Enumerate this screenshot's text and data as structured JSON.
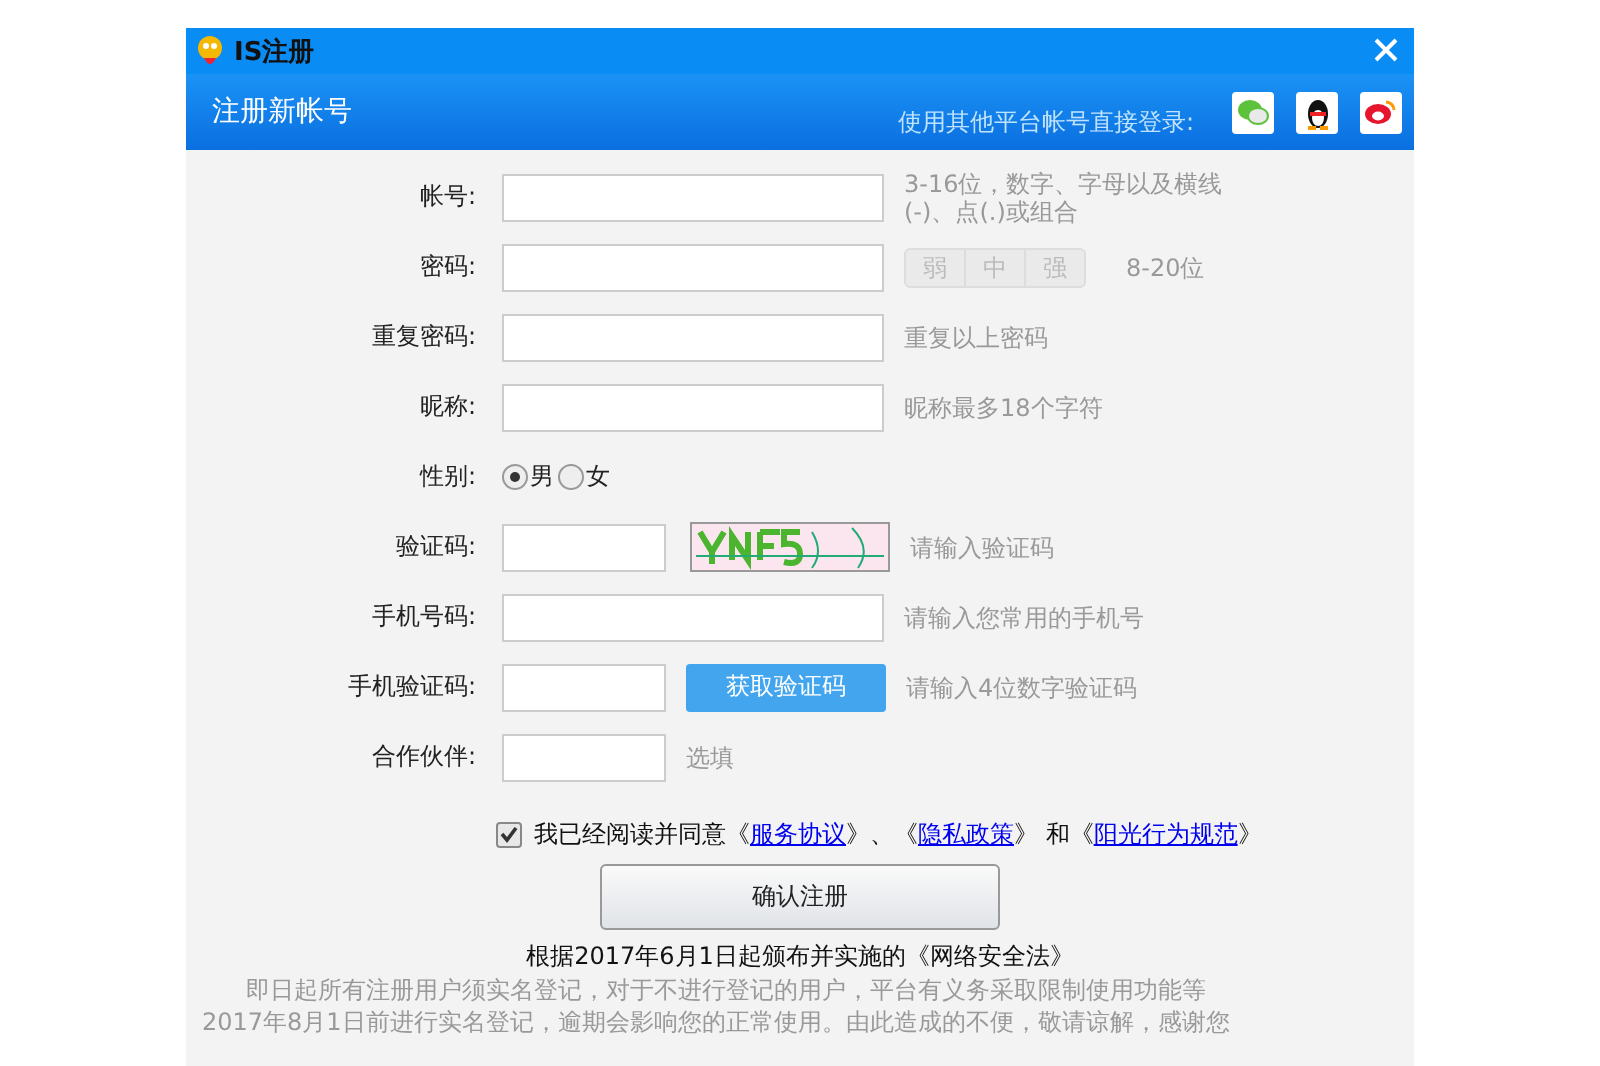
{
  "window": {
    "title": "IS注册"
  },
  "header": {
    "title": "注册新帐号",
    "social_label": "使用其他平台帐号直接登录:"
  },
  "rows": [
    {
      "kind": "input",
      "label": "帐号:",
      "hint": "3-16位，数字、字母以及横线(-)、点(.)或组合"
    },
    {
      "kind": "password",
      "label": "密码:",
      "strength": [
        "弱",
        "中",
        "强"
      ],
      "hint": "8-20位"
    },
    {
      "kind": "input",
      "label": "重复密码:",
      "hint": "重复以上密码"
    },
    {
      "kind": "input",
      "label": "昵称:",
      "hint": "昵称最多18个字符"
    },
    {
      "kind": "radio",
      "label": "性别:",
      "options": [
        {
          "label": "男",
          "selected": true
        },
        {
          "label": "女",
          "selected": false
        }
      ]
    },
    {
      "kind": "captcha",
      "label": "验证码:",
      "hint": "请输入验证码"
    },
    {
      "kind": "input",
      "label": "手机号码:",
      "hint": "请输入您常用的手机号"
    },
    {
      "kind": "sms",
      "label": "手机验证码:",
      "button": "获取验证码",
      "hint": "请输入4位数字验证码"
    },
    {
      "kind": "optional",
      "label": "合作伙伴:",
      "hint": "选填"
    }
  ],
  "agreement": {
    "checked": true,
    "text": "我已经阅读并同意《",
    "links": [
      "服务协议",
      "隐私政策",
      "阳光行为规范"
    ],
    "separators": [
      "》、《",
      "》 和《",
      "》"
    ]
  },
  "submit": "确认注册",
  "notice": {
    "title": "根据2017年6月1日起颁布并实施的《网络安全法》",
    "lines": [
      "即日起所有注册用户须实名登记，对于不进行登记的用户，平台有义务采取限制使用功能等",
      "2017年8月1日前进行实名登记，逾期会影响您的正常使用。由此造成的不便，敬请谅解，感谢您"
    ]
  }
}
